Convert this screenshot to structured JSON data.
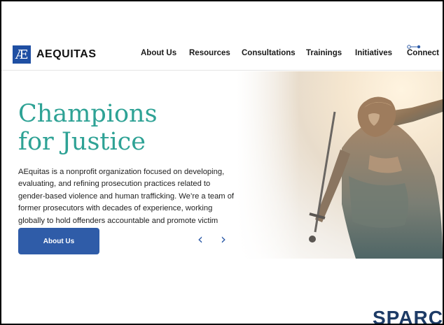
{
  "brand": {
    "mark": "Æ",
    "name": "AEQUITAS"
  },
  "nav": {
    "items": [
      {
        "label": "About Us"
      },
      {
        "label": "Resources"
      },
      {
        "label": "Consultations"
      },
      {
        "label": "Trainings"
      },
      {
        "label": "Initiatives"
      },
      {
        "label": "Connect"
      }
    ]
  },
  "hero": {
    "headline_line1": "Champions",
    "headline_line2": "for Justice",
    "body": "AEquitas is a nonprofit organization focused on developing, evaluating, and refining prosecution practices related to gender-based violence and human trafficking. We’re a team of former prosecutors with decades of experience, working globally to hold offenders accountable and promote victim safety.",
    "cta_label": "About Us",
    "prev_icon": "‹",
    "next_icon": "›",
    "image": "statue-of-justice-image"
  },
  "footer": {
    "partner_logo": "SPARC"
  },
  "colors": {
    "accent": "#2ea295",
    "button": "#2f5ca8",
    "brand": "#1f4fa3",
    "sparc": "#1d3b66"
  }
}
